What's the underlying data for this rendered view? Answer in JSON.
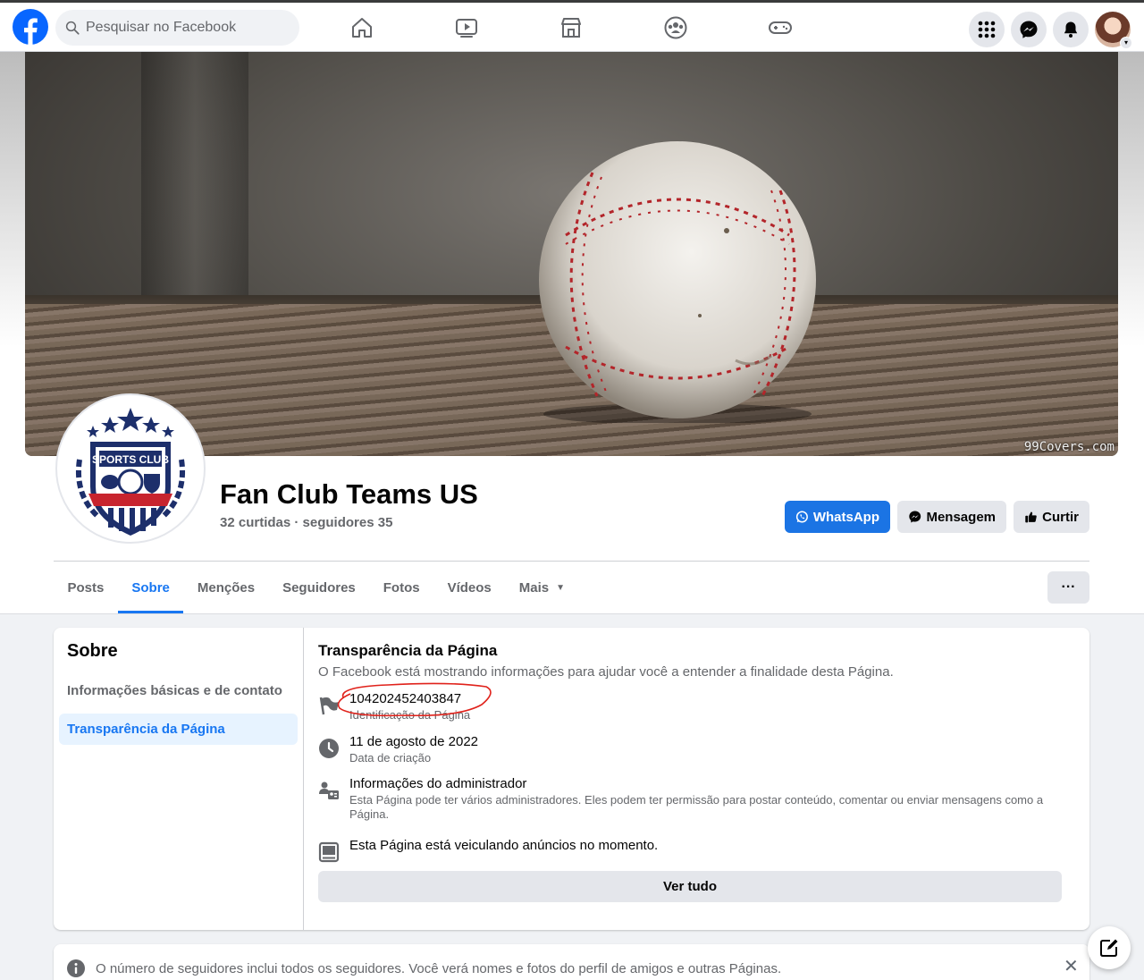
{
  "topbar": {
    "search_placeholder": "Pesquisar no Facebook",
    "nav_icons": [
      "home-icon",
      "watch-icon",
      "marketplace-icon",
      "groups-icon",
      "gaming-icon"
    ],
    "right_icons": [
      "menu-grid-icon",
      "messenger-icon",
      "notifications-icon"
    ]
  },
  "cover": {
    "watermark": "99Covers.com"
  },
  "profile": {
    "logo_text": "SPORTS CLUB",
    "name": "Fan Club Teams US",
    "stats": "32 curtidas · seguidores 35"
  },
  "actions": {
    "whatsapp": "WhatsApp",
    "message": "Mensagem",
    "like": "Curtir"
  },
  "tabs": [
    "Posts",
    "Sobre",
    "Menções",
    "Seguidores",
    "Fotos",
    "Vídeos",
    "Mais"
  ],
  "active_tab": "Sobre",
  "more_label": "···",
  "about": {
    "title": "Sobre",
    "side_items": [
      "Informações básicas e de contato",
      "Transparência da Página"
    ],
    "section_title": "Transparência da Página",
    "section_subtitle": "O Facebook está mostrando informações para ajudar você a entender a finalidade desta Página.",
    "rows": [
      {
        "icon": "flag-icon",
        "main": "104202452403847",
        "sub": "Identificação da Página"
      },
      {
        "icon": "clock-icon",
        "main": "11 de agosto de 2022",
        "sub": "Data de criação"
      },
      {
        "icon": "admin-icon",
        "main": "Informações do administrador",
        "sub": "Esta Página pode ter vários administradores. Eles podem ter permissão para postar conteúdo, comentar ou enviar mensagens como a Página."
      },
      {
        "icon": "ads-icon",
        "main": "Esta Página está veiculando anúncios no momento.",
        "sub": ""
      }
    ],
    "see_all": "Ver tudo"
  },
  "notice": {
    "text": "O número de seguidores inclui todos os seguidores. Você verá nomes e fotos do perfil de amigos e outras Páginas.",
    "close": "✕"
  },
  "colors": {
    "accent": "#1877f2",
    "whatsapp_button": "#1b74e4",
    "annotation": "#e0221b"
  }
}
